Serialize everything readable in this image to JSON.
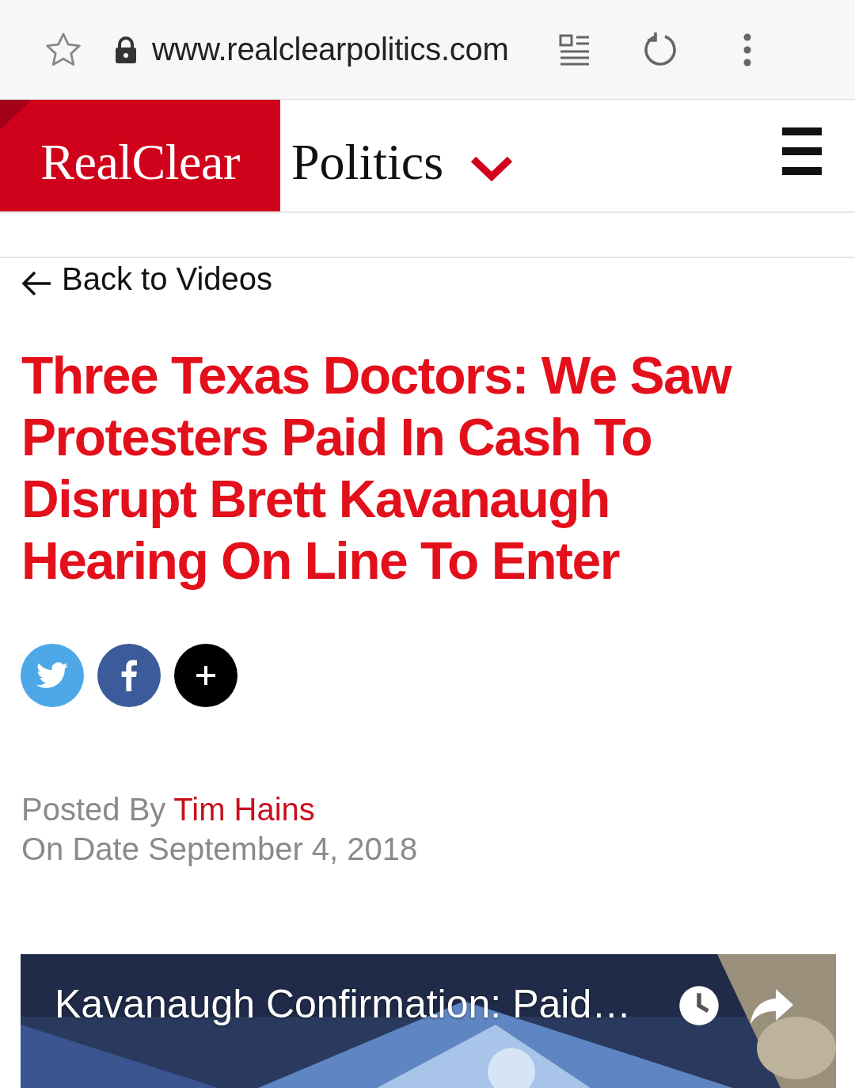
{
  "browser": {
    "url": "www.realclearpolitics.com"
  },
  "header": {
    "logo_brand": "RealClear",
    "logo_section": "Politics"
  },
  "back_link": "Back to Videos",
  "headline": "Three Texas Doctors: We Saw Protesters Paid In Cash To Disrupt Brett Kavanaugh Hearing On Line To Enter",
  "share_buttons": [
    {
      "kind": "twitter"
    },
    {
      "kind": "facebook"
    },
    {
      "kind": "more"
    }
  ],
  "byline": {
    "prefix": "Posted By",
    "author": "Tim Hains",
    "date": "On Date September 4, 2018"
  },
  "video": {
    "title": "Kavanaugh Confirmation: Paid…"
  }
}
